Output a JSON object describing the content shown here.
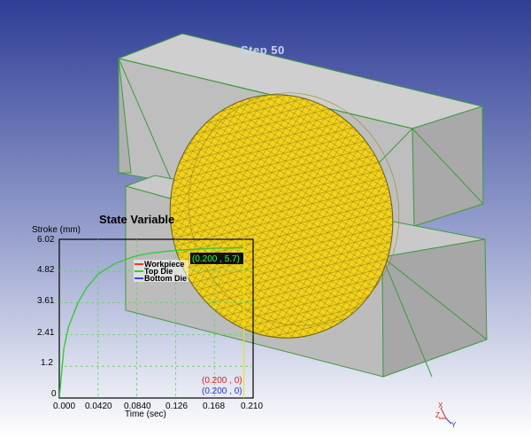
{
  "scene": {
    "step_label": "Step   50",
    "colors": {
      "background_top": "#2f3d96",
      "background_bottom": "#ffffff",
      "die_face": "#b9b9b9",
      "die_edge": "#3f9a3f",
      "workpiece_fill": "#f3d21c",
      "workpiece_mesh": "#8a7a18"
    }
  },
  "plot": {
    "title": "State Variable",
    "y_title": "Stroke (mm)",
    "x_title": "Time (sec)",
    "y_ticks": [
      "6.02",
      "4.82",
      "3.61",
      "2.41",
      "1.2",
      "0"
    ],
    "x_ticks": [
      "0.000",
      "0.0420",
      "0.0840",
      "0.126",
      "0.168",
      "0.210"
    ],
    "legend": [
      {
        "label": "Workpiece",
        "color": "#ff3030"
      },
      {
        "label": "Top Die",
        "color": "#33cc33"
      },
      {
        "label": "Bottom Die",
        "color": "#3344ff"
      }
    ],
    "top_die_readout": "(0.200 , 5.7)",
    "workpiece_readout": "(0.200 , 0)",
    "bottom_die_readout": "(0.200 , 0)",
    "workpiece_readout_color": "#e02020",
    "bottom_die_readout_color": "#2233dd"
  },
  "chart_data": {
    "type": "line",
    "title": "State Variable",
    "xlabel": "Time (sec)",
    "ylabel": "Stroke (mm)",
    "xlim": [
      0,
      0.21
    ],
    "ylim": [
      0,
      6.02
    ],
    "grid": true,
    "legend": "top-left",
    "series": [
      {
        "name": "Top Die",
        "color": "#33cc33",
        "x": [
          0,
          0.005,
          0.01,
          0.02,
          0.03,
          0.042,
          0.06,
          0.084,
          0.1,
          0.126,
          0.15,
          0.168,
          0.19,
          0.2
        ],
        "y": [
          0,
          1.9,
          2.7,
          3.6,
          4.2,
          4.7,
          5.1,
          5.4,
          5.5,
          5.6,
          5.65,
          5.68,
          5.7,
          5.7
        ]
      },
      {
        "name": "Workpiece",
        "color": "#ff3030",
        "x": [
          0,
          0.2
        ],
        "y": [
          0,
          0
        ]
      },
      {
        "name": "Bottom Die",
        "color": "#3344ff",
        "x": [
          0,
          0.2
        ],
        "y": [
          0,
          0
        ]
      }
    ]
  },
  "triad": {
    "x": "X",
    "y": "Y",
    "z": "Z"
  }
}
